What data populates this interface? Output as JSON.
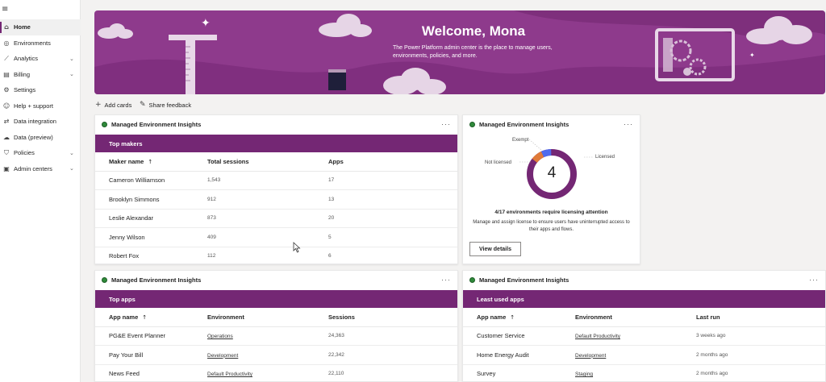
{
  "sidebar": {
    "items": [
      {
        "label": "Home",
        "icon": "home-icon",
        "glyph": "⌂",
        "chevron": ""
      },
      {
        "label": "Environments",
        "icon": "globe-icon",
        "glyph": "◎",
        "chevron": ""
      },
      {
        "label": "Analytics",
        "icon": "chart-icon",
        "glyph": "⟋",
        "chevron": "⌄"
      },
      {
        "label": "Billing",
        "icon": "billing-icon",
        "glyph": "▤",
        "chevron": "⌄"
      },
      {
        "label": "Settings",
        "icon": "gear-icon",
        "glyph": "⚙",
        "chevron": ""
      },
      {
        "label": "Help + support",
        "icon": "help-icon",
        "glyph": "☺",
        "chevron": ""
      },
      {
        "label": "Data integration",
        "icon": "data-integration-icon",
        "glyph": "⇄",
        "chevron": ""
      },
      {
        "label": "Data (preview)",
        "icon": "data-icon",
        "glyph": "☁",
        "chevron": ""
      },
      {
        "label": "Policies",
        "icon": "shield-icon",
        "glyph": "⛉",
        "chevron": "⌄"
      },
      {
        "label": "Admin centers",
        "icon": "admin-icon",
        "glyph": "▣",
        "chevron": "⌄"
      }
    ]
  },
  "banner": {
    "title": "Welcome, Mona",
    "subtitle": "The Power Platform admin center is the place to manage users, environments, policies, and more."
  },
  "commands": {
    "add_cards": "Add cards",
    "share_feedback": "Share feedback"
  },
  "card_title": "Managed Environment Insights",
  "top_makers": {
    "header": "Top makers",
    "columns": [
      "Maker name",
      "Total sessions",
      "Apps"
    ],
    "rows": [
      [
        "Cameron Williamson",
        "1,543",
        "17"
      ],
      [
        "Brooklyn Simmons",
        "912",
        "13"
      ],
      [
        "Leslie Alexandar",
        "873",
        "20"
      ],
      [
        "Jenny Wilson",
        "409",
        "5"
      ],
      [
        "Robert Fox",
        "112",
        "6"
      ]
    ]
  },
  "licensing": {
    "center_value": "4",
    "labels": {
      "exempt": "Exempt",
      "not_licensed": "Not licensed",
      "licensed": "Licensed"
    },
    "attention": "4/17 environments require licensing attention",
    "description": "Manage and assign license to ensure users have uninterrupted access to their apps and flows.",
    "button": "View details",
    "colors": {
      "licensed": "#742774",
      "not_licensed": "#e07b39",
      "exempt": "#4f6bed"
    }
  },
  "top_apps": {
    "header": "Top apps",
    "columns": [
      "App name",
      "Environment",
      "Sessions"
    ],
    "rows": [
      [
        "PG&E Event Planner",
        "Operations",
        "24,363"
      ],
      [
        "Pay Your Bill",
        "Development",
        "22,342"
      ],
      [
        "News Feed",
        "Default Productivity",
        "22,110"
      ]
    ]
  },
  "least_used": {
    "header": "Least used apps",
    "columns": [
      "App name",
      "Environment",
      "Last run"
    ],
    "rows": [
      [
        "Customer Service",
        "Default Productivity",
        "3 weeks ago"
      ],
      [
        "Home Energy Audit",
        "Development",
        "2 months ago"
      ],
      [
        "Survey",
        "Staging",
        "2 months ago"
      ]
    ]
  },
  "more_label": "···",
  "sort_glyph": "↑",
  "hamburger": "≡",
  "theme": {
    "accent": "#742774",
    "banner": "#8e3a8c"
  }
}
